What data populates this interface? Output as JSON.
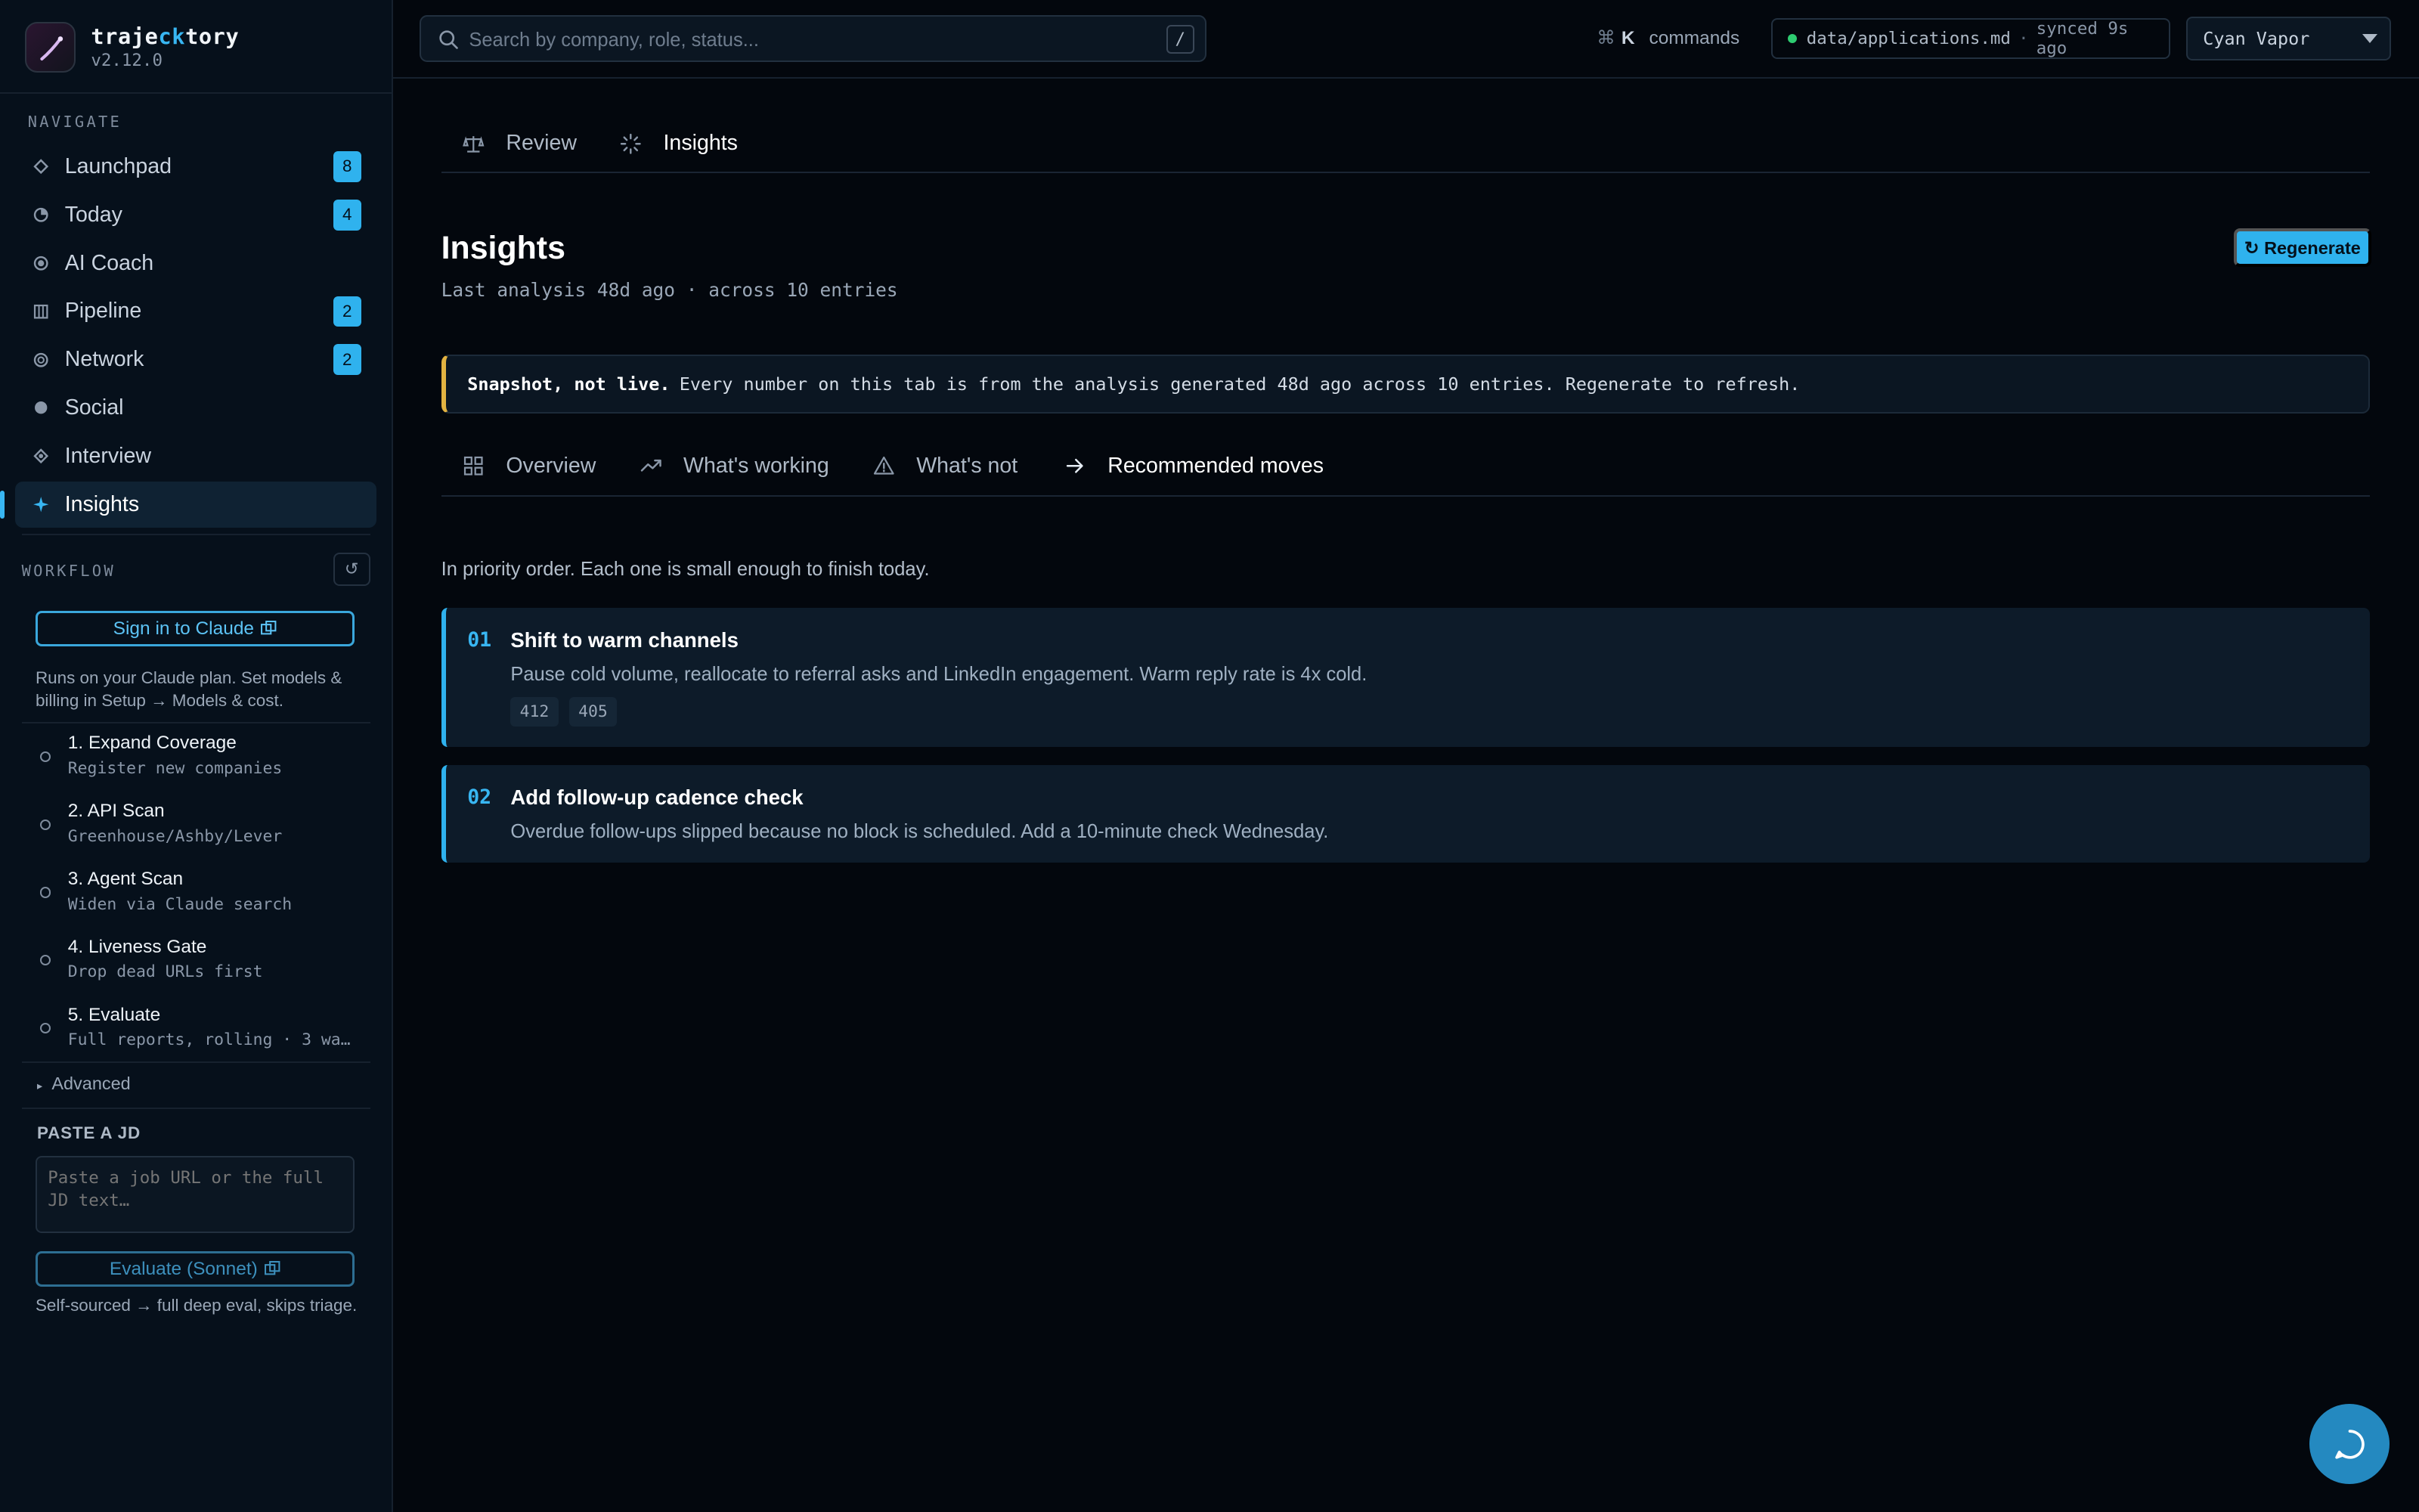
{
  "brand": {
    "name_start": "traje",
    "name_accent": "ck",
    "name_end": "tory",
    "version": "v2.12.0"
  },
  "sidebar": {
    "navigate_label": "NAVIGATE",
    "nav": [
      {
        "label": "Launchpad",
        "icon": "diamond-icon",
        "badge": "8"
      },
      {
        "label": "Today",
        "icon": "clock-icon",
        "badge": "4"
      },
      {
        "label": "AI Coach",
        "icon": "target-icon",
        "badge": ""
      },
      {
        "label": "Pipeline",
        "icon": "columns-icon",
        "badge": "2"
      },
      {
        "label": "Network",
        "icon": "network-icon",
        "badge": "2"
      },
      {
        "label": "Social",
        "icon": "circle-icon",
        "badge": ""
      },
      {
        "label": "Interview",
        "icon": "diamond-dot-icon",
        "badge": ""
      },
      {
        "label": "Insights",
        "icon": "sparkle-icon",
        "badge": "",
        "active": true
      }
    ],
    "workflow_label": "WORKFLOW",
    "sign_in_label": "Sign in to Claude",
    "sign_in_note": "Runs on your Claude plan. Set models & billing in Setup → Models & cost.",
    "steps": [
      {
        "title": "1. Expand Coverage",
        "subtitle": "Register new companies"
      },
      {
        "title": "2. API Scan",
        "subtitle": "Greenhouse/Ashby/Lever"
      },
      {
        "title": "3. Agent Scan",
        "subtitle": "Widen via Claude search"
      },
      {
        "title": "4. Liveness Gate",
        "subtitle": "Drop dead URLs first"
      },
      {
        "title": "5. Evaluate",
        "subtitle": "Full reports, rolling · 3 wai…"
      }
    ],
    "advanced_label": "Advanced",
    "paste_label": "PASTE A JD",
    "paste_placeholder": "Paste a job URL or the full JD text…",
    "evaluate_label": "Evaluate (Sonnet)",
    "evaluate_note": "Self-sourced → full deep eval, skips triage."
  },
  "topbar": {
    "search_placeholder": "Search by company, role, status...",
    "search_shortcut": "/",
    "cmd_symbol": "⌘",
    "cmd_key": "K",
    "cmd_label": "commands",
    "sync_file": "data/applications.md",
    "sync_status": "synced 9s ago",
    "theme": "Cyan Vapor"
  },
  "main": {
    "top_tabs": [
      {
        "label": "Review",
        "icon": "scale-icon"
      },
      {
        "label": "Insights",
        "icon": "loader-icon",
        "active": true
      }
    ],
    "title": "Insights",
    "subtitle": "Last analysis 48d ago · across 10 entries",
    "regenerate_label": "↻ Regenerate",
    "snapshot_bold": "Snapshot, not live.",
    "snapshot_text": "Every number on this tab is from the analysis generated 48d ago across 10 entries. Regenerate to refresh.",
    "sub_tabs": [
      {
        "label": "Overview",
        "icon": "grid-icon"
      },
      {
        "label": "What's working",
        "icon": "trend-up-icon"
      },
      {
        "label": "What's not",
        "icon": "warning-icon"
      },
      {
        "label": "Recommended moves",
        "icon": "arrow-right-icon",
        "active": true
      }
    ],
    "intro": "In priority order. Each one is small enough to finish today.",
    "moves": [
      {
        "num": "01",
        "title": "Shift to warm channels",
        "desc": "Pause cold volume, reallocate to referral asks and LinkedIn engagement. Warm reply rate is 4x cold.",
        "chips": [
          "412",
          "405"
        ]
      },
      {
        "num": "02",
        "title": "Add follow-up cadence check",
        "desc": "Overdue follow-ups slipped because no block is scheduled. Add a 10-minute check Wednesday.",
        "chips": []
      }
    ]
  },
  "colors": {
    "accent": "#2fb2ee",
    "warning": "#e3b341",
    "sync_ok": "#2ecc71"
  }
}
